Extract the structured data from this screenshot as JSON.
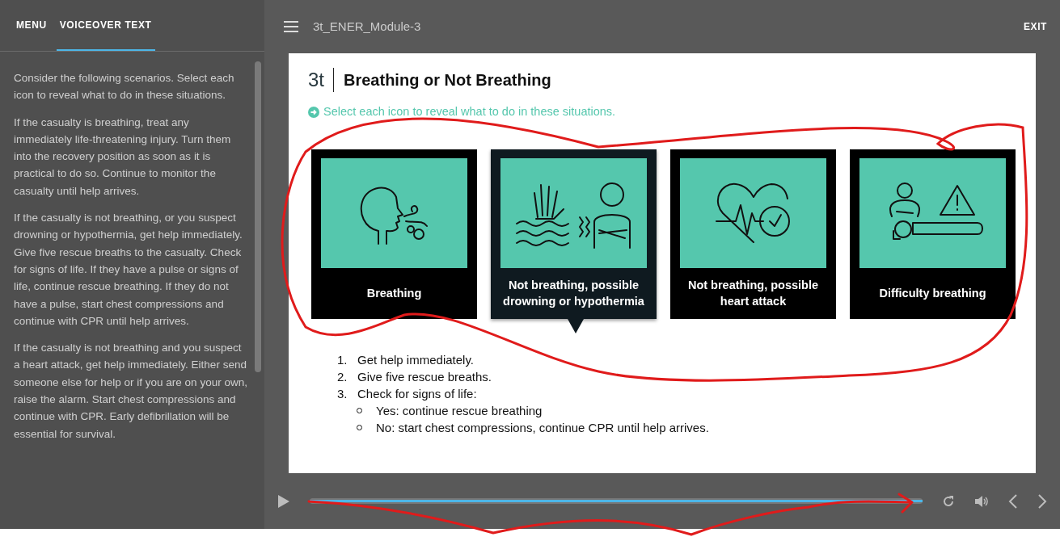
{
  "sidebar": {
    "tabs": [
      {
        "label": "MENU",
        "selected": false
      },
      {
        "label": "VOICEOVER TEXT",
        "selected": true
      }
    ],
    "paragraphs": [
      "Consider the following scenarios. Select each icon to reveal what to do in these situations.",
      "If the casualty is breathing, treat any immediately life-threatening injury. Turn them into the recovery position as soon as it is practical to do so. Continue to monitor the casualty until help arrives.",
      "If the casualty is not breathing, or you suspect drowning or hypothermia, get help immediately. Give five rescue breaths to the casualty. Check for signs of life. If they have a pulse or signs of life, continue rescue breathing. If they do not have a pulse, start chest compressions and continue with CPR until help arrives.",
      "If the casualty is not breathing and you suspect a heart attack, get help immediately. Either send someone else for help or if you are on your own, raise the alarm. Start chest compressions and continue with CPR. Early defibrillation will be essential for survival."
    ]
  },
  "header": {
    "title": "3t_ENER_Module-3",
    "exit": "EXIT"
  },
  "slide": {
    "logo": "3t",
    "title": "Breathing or Not Breathing",
    "instruction": "Select each icon to reveal what to do in these situations.",
    "cards": [
      {
        "label": "Breathing",
        "selected": false
      },
      {
        "label": "Not breathing, possible drowning or hypothermia",
        "selected": true
      },
      {
        "label": "Not breathing, possible heart attack",
        "selected": false
      },
      {
        "label": "Difficulty breathing",
        "selected": false
      }
    ],
    "steps": [
      {
        "number": "1.",
        "text": "Get help immediately."
      },
      {
        "number": "2.",
        "text": "Give five rescue breaths."
      },
      {
        "number": "3.",
        "text": "Check for signs of life:",
        "children": [
          "Yes: continue rescue breathing",
          "No: start chest compressions, continue CPR until help arrives."
        ]
      }
    ]
  },
  "player": {
    "progress": {
      "level": 1
    }
  }
}
